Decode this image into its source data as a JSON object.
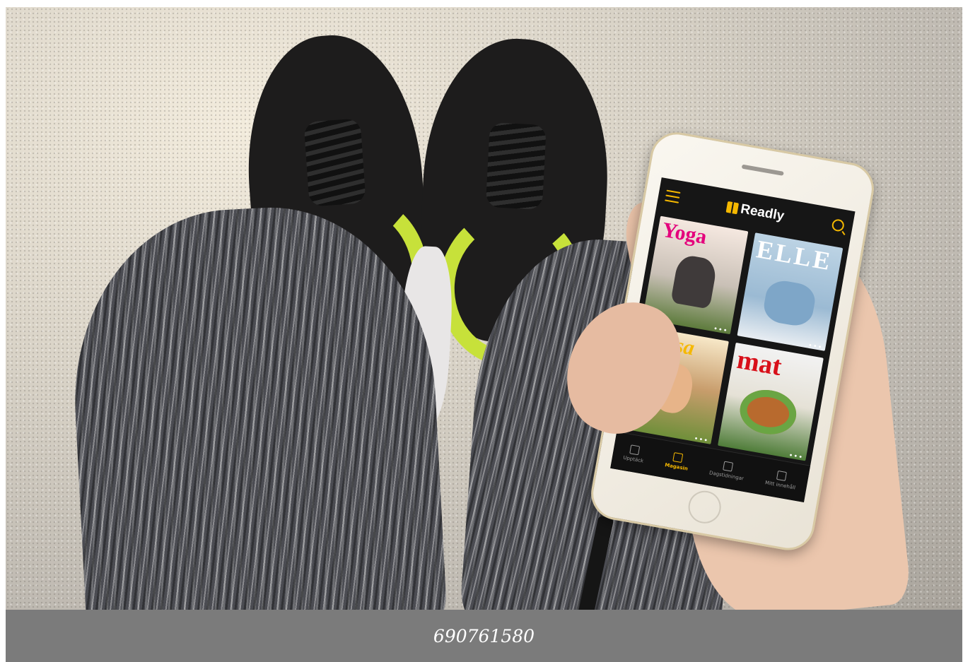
{
  "photo": {
    "app": {
      "logo_text": "Readly",
      "accent_color": "#f5b800",
      "background_color": "#161616",
      "covers": [
        {
          "title": "Yoga",
          "dots": "•••"
        },
        {
          "title": "ELLE",
          "dots": "•••"
        },
        {
          "title": "Hälsa",
          "dots": "•••"
        },
        {
          "title": "mat",
          "dots": "•••"
        }
      ],
      "nav": [
        {
          "label": "Upptäck",
          "icon": "home-icon",
          "active": false
        },
        {
          "label": "Magasin",
          "icon": "book-icon",
          "active": true
        },
        {
          "label": "Dagstidningar",
          "icon": "newspaper-icon",
          "active": false
        },
        {
          "label": "Mitt innehåll",
          "icon": "user-icon",
          "active": false
        }
      ]
    }
  },
  "caption": {
    "text": "690761580"
  }
}
